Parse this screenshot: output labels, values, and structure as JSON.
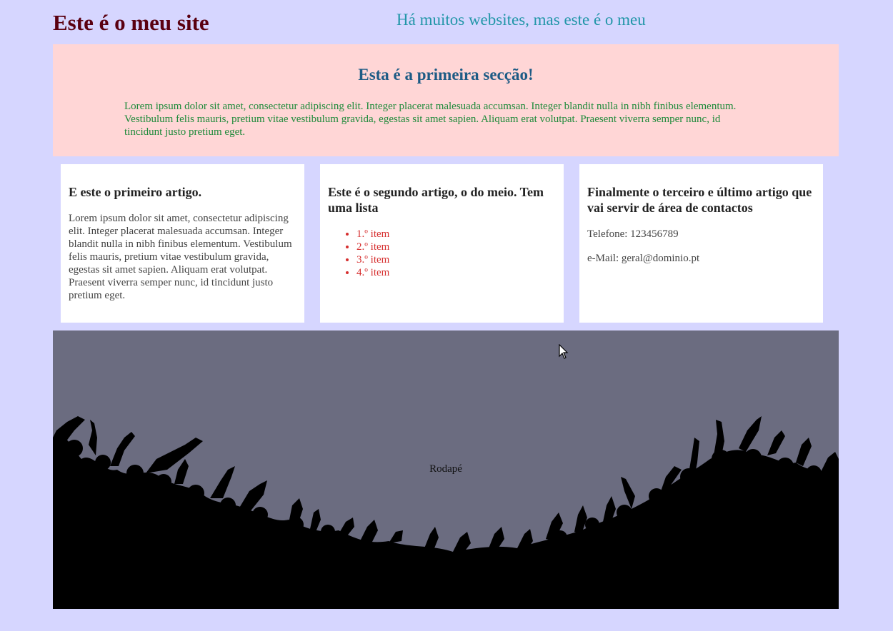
{
  "header": {
    "site_title": "Este é o meu site",
    "tagline": "Há muitos websites, mas este é o meu"
  },
  "hero": {
    "title": "Esta é a primeira secção!",
    "text": "Lorem ipsum dolor sit amet, consectetur adipiscing elit. Integer placerat malesuada accumsan. Integer blandit nulla in nibh finibus elementum. Vestibulum felis mauris, pretium vitae vestibulum gravida, egestas sit amet sapien. Aliquam erat volutpat. Praesent viverra semper nunc, id tincidunt justo pretium eget."
  },
  "articles": [
    {
      "title": "E este o primeiro artigo.",
      "text": "Lorem ipsum dolor sit amet, consectetur adipiscing elit. Integer placerat malesuada accumsan. Integer blandit nulla in nibh finibus elementum. Vestibulum felis mauris, pretium vitae vestibulum gravida, egestas sit amet sapien. Aliquam erat volutpat. Praesent viverra semper nunc, id tincidunt justo pretium eget."
    },
    {
      "title": "Este é o segundo artigo, o do meio. Tem uma lista",
      "items": [
        "1.º item",
        "2.º item",
        "3.º item",
        "4.º item"
      ]
    },
    {
      "title": "Finalmente o terceiro e último artigo que vai servir de área de contactos",
      "phone": "Telefone: 123456789",
      "email": "e-Mail: geral@dominio.pt"
    }
  ],
  "footer": {
    "label": "Rodapé"
  },
  "colors": {
    "background": "#d6d6ff",
    "hero_background": "#ffd6d6",
    "footer_background": "#6b6c80"
  }
}
